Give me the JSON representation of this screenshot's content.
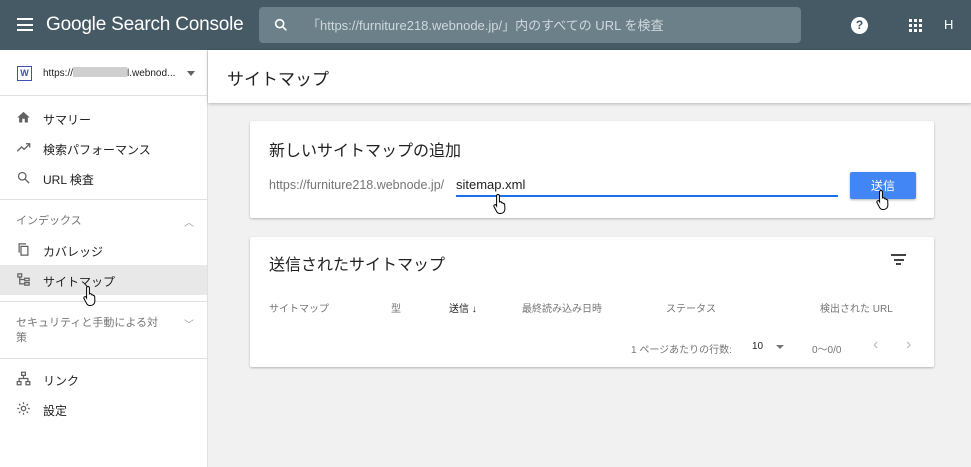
{
  "app": {
    "title": "Google Search Console",
    "avatar_initial": "H",
    "help_glyph": "?"
  },
  "search": {
    "placeholder": "「https://furniture218.webnode.jp/」内のすべての URL を検査"
  },
  "sidebar": {
    "property": {
      "favicon_letter": "W",
      "prefix": "https://",
      "suffix": "l.webnod..."
    },
    "items": [
      {
        "label": "サマリー",
        "icon": "home-icon"
      },
      {
        "label": "検索パフォーマンス",
        "icon": "trending-up-icon"
      },
      {
        "label": "URL 検査",
        "icon": "search-icon"
      }
    ],
    "index_section": {
      "label": "インデックス",
      "items": [
        {
          "label": "カバレッジ",
          "icon": "copy-icon"
        },
        {
          "label": "サイトマップ",
          "icon": "sitemap-icon"
        }
      ]
    },
    "security_section": {
      "label_line1": "セキュリティと手動による対",
      "label_line2": "策"
    },
    "bottom_items": [
      {
        "label": "リンク",
        "icon": "links-icon"
      },
      {
        "label": "設定",
        "icon": "gear-icon"
      }
    ]
  },
  "main": {
    "page_title": "サイトマップ",
    "add_card": {
      "title": "新しいサイトマップの追加",
      "url_prefix": "https://furniture218.webnode.jp/",
      "input_value": "sitemap.xml",
      "submit_label": "送信"
    },
    "submitted_card": {
      "title": "送信されたサイトマップ",
      "columns": [
        "サイトマップ",
        "型",
        "送信 ↓",
        "最終読み込み日時",
        "ステータス",
        "検出された URL"
      ],
      "pager": {
        "rows_label": "1 ページあたりの行数:",
        "rows_value": "10",
        "range": "0～0/0",
        "prev": "‹",
        "next": "›"
      }
    }
  },
  "colors": {
    "topbar": "#455a64",
    "accent": "#4285f4",
    "input_underline": "#1a73e8"
  }
}
